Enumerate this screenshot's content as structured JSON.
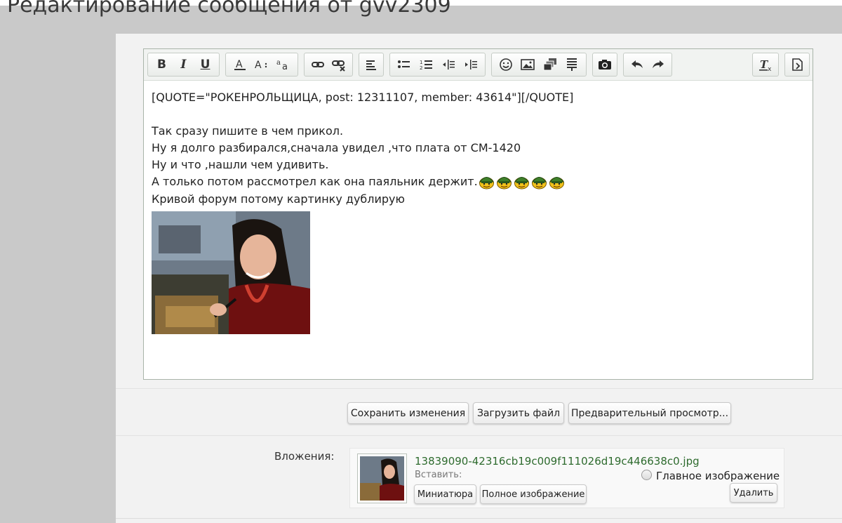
{
  "page": {
    "title": "Редактирование сообщения от gvv2309"
  },
  "toolbar": {
    "groups": [
      [
        "bold-icon",
        "italic-icon",
        "underline-icon"
      ],
      [
        "text-color-icon",
        "font-size-icon",
        "font-family-icon"
      ],
      [
        "link-icon",
        "unlink-icon"
      ],
      [
        "align-icon"
      ],
      [
        "bulleted-list-icon",
        "numbered-list-icon",
        "outdent-icon",
        "indent-icon"
      ],
      [
        "smilies-icon",
        "image-icon",
        "media-icon",
        "quote-icon"
      ],
      [
        "camera-icon"
      ],
      [
        "undo-icon",
        "redo-icon"
      ],
      [
        "remove-format-icon"
      ],
      [
        "toggle-bbcode-icon"
      ]
    ],
    "bold_glyph": "B",
    "italic_glyph": "I",
    "underline_glyph": "U"
  },
  "editor": {
    "lines": [
      "[QUOTE=\"РОКЕНРОЛЬЩИЦА, post: 12311107, member: 43614\"][/QUOTE]",
      "",
      "Так сразу пишите в чем прикол.",
      "Ну я долго разбирался,сначала увидел ,что плата от СМ-1420",
      "Ну и что ,нашли чем удивить.",
      "А только потом рассмотрел как она паяльник держит.",
      "Кривой форум потому картинку дублирую"
    ],
    "smiley_count": 5
  },
  "buttons": {
    "save": "Сохранить изменения",
    "upload": "Загрузить файл",
    "preview": "Предварительный просмотр..."
  },
  "attachments": {
    "label": "Вложения:",
    "items": [
      {
        "filename": "13839090-42316cb19c009f111026d19c446638c0.jpg",
        "insert_label": "Вставить:",
        "thumbnail_button": "Миниатюра",
        "full_image_button": "Полное изображение",
        "main_image_label": "Главное изображение",
        "delete_button": "Удалить"
      }
    ]
  },
  "colors": {
    "accent_green": "#2e6b2e",
    "panel_bg": "#f2f2f2",
    "page_bg": "#c9c9c9"
  }
}
